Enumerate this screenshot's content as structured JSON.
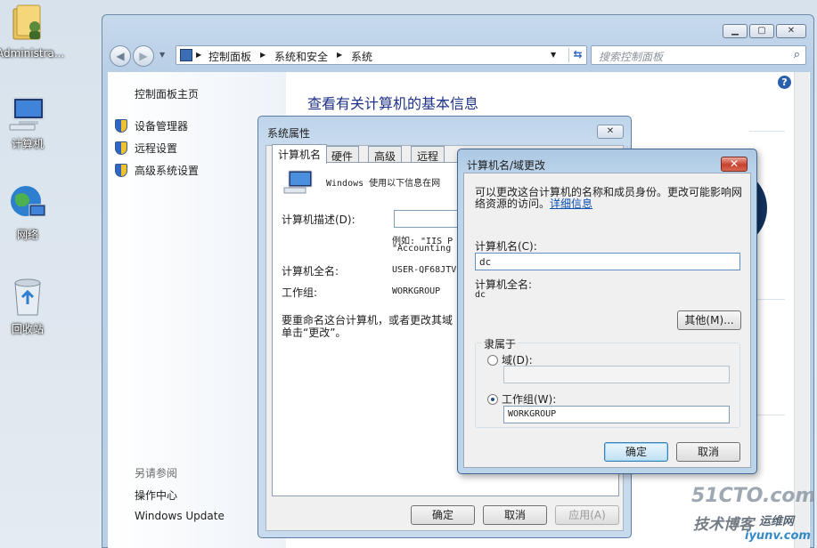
{
  "desktop": {
    "icons": [
      {
        "label": "Administra..."
      },
      {
        "label": "计算机"
      },
      {
        "label": "网络"
      },
      {
        "label": "回收站"
      }
    ]
  },
  "control_panel": {
    "breadcrumb": [
      "控制面板",
      "系统和安全",
      "系统"
    ],
    "search_placeholder": "搜索控制面板",
    "left_nav": {
      "home": "控制面板主页",
      "links": [
        "设备管理器",
        "远程设置",
        "高级系统设置"
      ],
      "see_also_title": "另请参阅",
      "see_also": [
        "操作中心",
        "Windows Update"
      ]
    },
    "main_title": "查看有关计算机的基本信息",
    "help_glyph": "?"
  },
  "system_properties": {
    "title": "系统属性",
    "tabs": [
      "计算机名",
      "硬件",
      "高级",
      "远程"
    ],
    "desc_text": "Windows 使用以下信息在网",
    "computer_desc_label": "计算机描述(D):",
    "computer_desc_value": "",
    "example_line1": "例如: \"IIS P",
    "example_line2": "\"Accounting",
    "full_name_label": "计算机全名:",
    "full_name_value": "USER-QF68JTV",
    "workgroup_label": "工作组:",
    "workgroup_value": "WORKGROUP",
    "rename_line1": "要重命名这台计算机，或者更改其域",
    "rename_line2": "单击“更改”。",
    "buttons": {
      "ok": "确定",
      "cancel": "取消",
      "apply": "应用(A)"
    }
  },
  "name_dialog": {
    "title": "计算机名/域更改",
    "intro_line1": "可以更改这台计算机的名称和成员身份。更改可能影响网",
    "intro_line2": "络资源的访问。",
    "details_link": "详细信息",
    "computer_name_label": "计算机名(C):",
    "computer_name_value": "dc",
    "full_name_label": "计算机全名:",
    "full_name_value": "dc",
    "more_button": "其他(M)...",
    "member_of_label": "隶属于",
    "domain_label": "域(D):",
    "domain_value": "",
    "workgroup_label": "工作组(W):",
    "workgroup_value": "WORKGROUP",
    "selected_membership": "workgroup",
    "buttons": {
      "ok": "确定",
      "cancel": "取消"
    }
  },
  "watermark": {
    "line1": "51CTO.com",
    "line2": "技术博客",
    "line3": "运维网",
    "line4": "iyunv.com"
  }
}
